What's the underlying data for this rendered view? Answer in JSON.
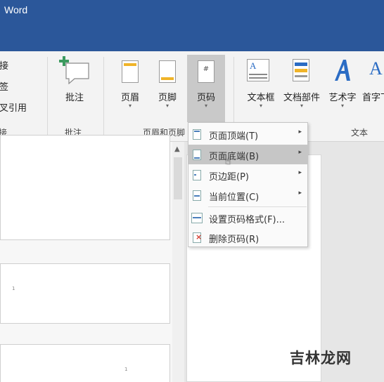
{
  "title_bar": {
    "app_name": "Word"
  },
  "ribbon": {
    "links_group": {
      "items": [
        "链接",
        "书签",
        "交叉引用"
      ],
      "group_label": "链接"
    },
    "comment_group": {
      "button_label": "批注",
      "group_label": "批注"
    },
    "header_footer_group": {
      "header_label": "页眉",
      "footer_label": "页脚",
      "page_number_label": "页码",
      "group_label": "页眉和页脚"
    },
    "text_group": {
      "textbox_label": "文本框",
      "quickparts_label": "文档部件",
      "wordart_label": "艺术字",
      "dropcap_label": "首字下沉",
      "group_label": "文本"
    },
    "caret": "▾"
  },
  "page_number_menu": {
    "items": [
      {
        "label": "页面顶端(T)",
        "has_submenu": true,
        "highlighted": false,
        "icon": "page-top-icon"
      },
      {
        "label": "页面底端(B)",
        "has_submenu": true,
        "highlighted": true,
        "icon": "page-bottom-icon"
      },
      {
        "label": "页边距(P)",
        "has_submenu": true,
        "highlighted": false,
        "icon": "page-margin-icon"
      },
      {
        "label": "当前位置(C)",
        "has_submenu": true,
        "highlighted": false,
        "icon": "current-position-icon"
      },
      {
        "label": "设置页码格式(F)...",
        "has_submenu": false,
        "highlighted": false,
        "icon": "format-page-number-icon"
      },
      {
        "label": "删除页码(R)",
        "has_submenu": false,
        "highlighted": false,
        "icon": "remove-page-number-icon"
      }
    ],
    "submenu_arrow": "▸"
  },
  "thumbnails": {
    "page_numbers": [
      "1",
      "1"
    ]
  },
  "watermark": "吉林龙网",
  "colors": {
    "title_bar": "#2b579a",
    "ribbon_bg": "#f3f3f3",
    "highlight": "#c6c6c6",
    "accent_yellow": "#f0b429",
    "wordart_blue": "#2b6cc4"
  }
}
